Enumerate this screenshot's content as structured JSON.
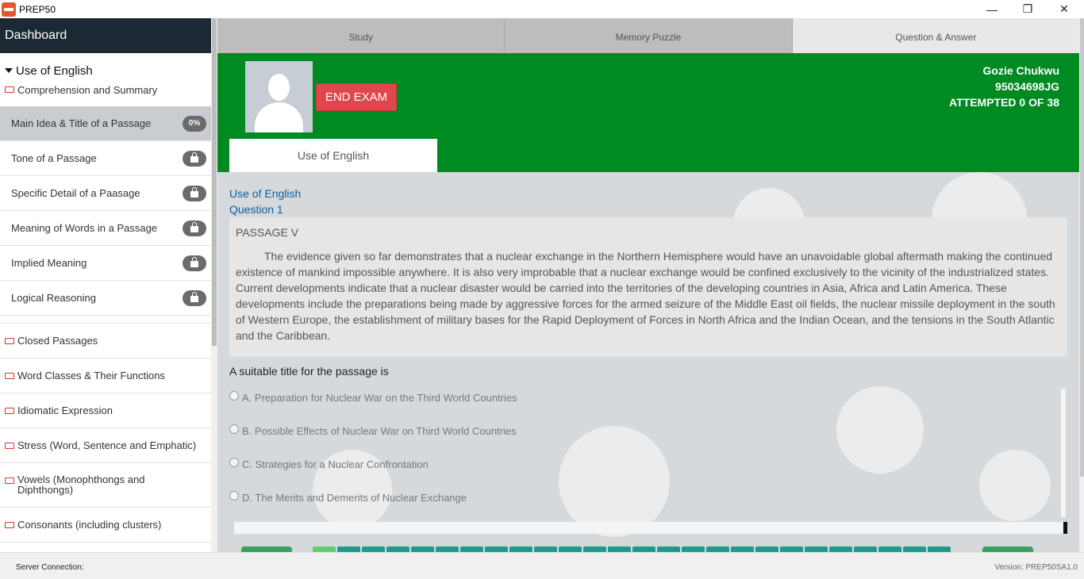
{
  "window": {
    "title": "PREP50",
    "logo_text": "PREP50",
    "controls": {
      "minimize": "—",
      "restore": "❐",
      "close": "✕"
    }
  },
  "sidebar": {
    "header": "Dashboard",
    "subject": "Use of English",
    "first_category": "Comprehension and Summary",
    "topics": [
      {
        "label": "Main Idea & Title of a Passage",
        "status": "0%",
        "active": true
      },
      {
        "label": "Tone of a Passage",
        "status": "locked"
      },
      {
        "label": "Specific Detail of a Paasage",
        "status": "locked"
      },
      {
        "label": "Meaning of Words in a Passage",
        "status": "locked"
      },
      {
        "label": "Implied Meaning",
        "status": "locked"
      },
      {
        "label": "Logical Reasoning",
        "status": "locked"
      }
    ],
    "categories": [
      "Closed Passages",
      "Word Classes & Their Functions",
      "Idiomatic Expression",
      "Stress (Word, Sentence and Emphatic)",
      "Vowels (Monophthongs and Diphthongs)",
      "Consonants (including clusters)"
    ]
  },
  "tabs": [
    {
      "label": "Study",
      "active": false
    },
    {
      "label": "Memory Puzzle",
      "active": false
    },
    {
      "label": "Question & Answer",
      "active": true
    }
  ],
  "exam": {
    "end_exam_label": "END EXAM",
    "user_name": "Gozie Chukwu",
    "user_id": "95034698JG",
    "attempted": "ATTEMPTED 0 OF 38",
    "subject_tab": "Use of English",
    "subject_heading": "Use of English",
    "question_label": "Question 1",
    "passage_title": "PASSAGE V",
    "passage_body": "The evidence given so far demonstrates that a nuclear exchange in the Northern Hemisphere would have an unavoidable global aftermath making the continued existence of mankind impossible anywhere. It is also very improbable that a nuclear exchange would be confined exclusively to the vicinity of the industrialized states. Current developments indicate that a nuclear disaster would be carried into the territories of the developing countries in Asia, Africa and Latin America. These developments include the preparations being made by aggressive forces for the armed seizure of the Middle East oil fields, the nuclear missile deployment in the south of Western Europe, the establishment of military bases for the Rapid Deployment of Forces in North Africa and the Indian Ocean, and the tensions in the South Atlantic and the Caribbean.",
    "question": "A suitable title for the passage is",
    "options": [
      "A. Preparation for Nuclear War on the Third World Countries",
      "B. Possible Effects of Nuclear War on Third World Countries",
      "C. Strategies for a Nuclear Confrontation",
      "D. The Merits and Demerits of Nuclear Exchange"
    ]
  },
  "footer": {
    "server_connection": "Server Connection:",
    "version_label": "Version:",
    "version_value": "PREP50SA1.0"
  },
  "colors": {
    "header_green": "#008a22",
    "end_exam_red": "#e0474c",
    "sidebar_dark": "#1c2833",
    "link_blue": "#0a5fa3"
  }
}
